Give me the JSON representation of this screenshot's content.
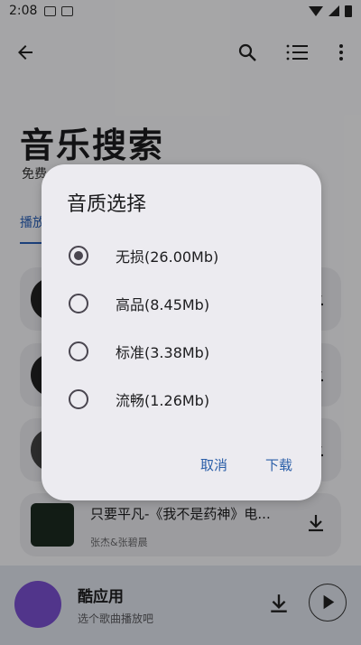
{
  "status_bar": {
    "time": "2:08"
  },
  "page": {
    "title": "音乐搜索",
    "subtitle": "免费",
    "active_tab": "播放"
  },
  "songs": [
    {
      "title": "",
      "artist": ""
    },
    {
      "title": "",
      "artist": ""
    },
    {
      "title": "",
      "artist": ""
    },
    {
      "title": "只要平凡-《我不是药神》电...",
      "artist": "张杰&张碧晨"
    }
  ],
  "player": {
    "title": "酷应用",
    "subtitle": "选个歌曲播放吧"
  },
  "dialog": {
    "title": "音质选择",
    "options": [
      {
        "label": "无损(26.00Mb)",
        "selected": true
      },
      {
        "label": "高品(8.45Mb)",
        "selected": false
      },
      {
        "label": "标准(3.38Mb)",
        "selected": false
      },
      {
        "label": "流畅(1.26Mb)",
        "selected": false
      }
    ],
    "cancel_label": "取消",
    "confirm_label": "下载"
  },
  "colors": {
    "accent": "#2a5ea8",
    "scrim": "rgba(0,0,0,0.33)"
  }
}
